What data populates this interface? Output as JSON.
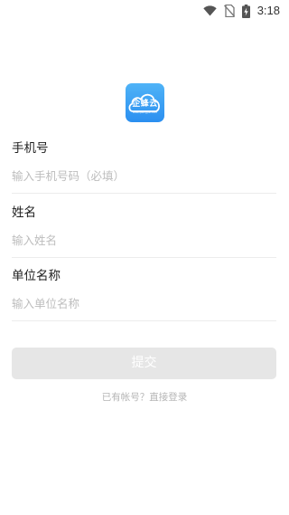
{
  "status_bar": {
    "time": "3:18",
    "icons": [
      "wifi-icon",
      "no-sim-icon",
      "battery-charging-icon"
    ]
  },
  "logo": {
    "word": "企蜂云",
    "url": "www.qifengyun.com"
  },
  "form": {
    "phone": {
      "label": "手机号",
      "placeholder": "输入手机号码（必填）",
      "value": ""
    },
    "name": {
      "label": "姓名",
      "placeholder": "输入姓名",
      "value": ""
    },
    "org": {
      "label": "单位名称",
      "placeholder": "输入单位名称",
      "value": ""
    }
  },
  "submit_label": "提交",
  "login_link": "已有帐号？直接登录",
  "colors": {
    "logo_top": "#4fb3f7",
    "logo_bottom": "#2b8ff0",
    "button_disabled": "#e6e6e6",
    "placeholder": "#bdbdbd"
  }
}
